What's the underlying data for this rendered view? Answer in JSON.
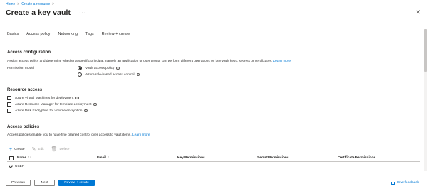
{
  "breadcrumb": {
    "items": [
      "Home",
      "Create a resource"
    ],
    "separator": ">"
  },
  "page": {
    "title": "Create a key vault",
    "more": "···",
    "close": "✕"
  },
  "tabs": [
    "Basics",
    "Access policy",
    "Networking",
    "Tags",
    "Review + create"
  ],
  "access_config": {
    "title": "Access configuration",
    "description": "Assign access policy and determine whether a specific principal, namely an application or user group, can perform different operations on key vault keys, secrets or certificates.",
    "learn_more": "Learn more",
    "permission_label": "Permission model",
    "options": [
      "Vault access policy",
      "Azure role-based access control"
    ],
    "selected": "Vault access policy"
  },
  "resource_access": {
    "title": "Resource access",
    "options": [
      "Azure Virtual Machines for deployment",
      "Azure Resource Manager for template deployment",
      "Azure Disk Encryption for volume encryption"
    ]
  },
  "access_policies": {
    "title": "Access policies",
    "description": "Access policies enable you to have fine grained control over access to vault items.",
    "learn_more": "Learn more",
    "toolbar": {
      "create": "Create",
      "edit": "Edit",
      "delete": "Delete"
    },
    "columns": [
      "Name",
      "Email",
      "Key Permissions",
      "Secret Permissions",
      "Certificate Permissions"
    ],
    "sort_glyph": "↑↓",
    "groups": [
      "USER"
    ]
  },
  "footer": {
    "previous": "Previous",
    "next": "Next",
    "review": "Review + create",
    "feedback": "Give feedback"
  },
  "colors": {
    "accent": "#0078d4",
    "text": "#323130",
    "border": "#8a8886"
  },
  "icons": {
    "info": "info-icon",
    "create": "plus-icon",
    "edit": "edit-icon",
    "delete": "delete-icon",
    "feedback": "feedback-icon"
  }
}
